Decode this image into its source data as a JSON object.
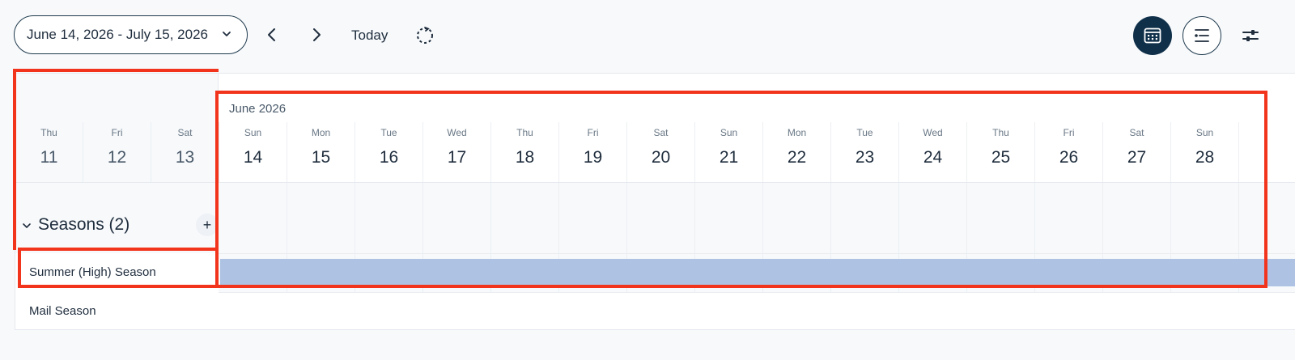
{
  "toolbar": {
    "date_range": "June 14, 2026 - July 15, 2026",
    "today_label": "Today",
    "icons": {
      "date_dropdown": "chevron-down-icon",
      "prev": "chevron-left-icon",
      "next": "chevron-right-icon",
      "refresh": "refresh-icon",
      "calendar_view": "calendar-grid-icon",
      "list_view": "list-icon",
      "filters": "sliders-icon"
    },
    "active_view": "calendar"
  },
  "calendar": {
    "month_label": "June 2026",
    "days": [
      {
        "dow": "Thu",
        "num": "11"
      },
      {
        "dow": "Fri",
        "num": "12"
      },
      {
        "dow": "Sat",
        "num": "13"
      },
      {
        "dow": "Sun",
        "num": "14"
      },
      {
        "dow": "Mon",
        "num": "15"
      },
      {
        "dow": "Tue",
        "num": "16"
      },
      {
        "dow": "Wed",
        "num": "17"
      },
      {
        "dow": "Thu",
        "num": "18"
      },
      {
        "dow": "Fri",
        "num": "19"
      },
      {
        "dow": "Sat",
        "num": "20"
      },
      {
        "dow": "Sun",
        "num": "21"
      },
      {
        "dow": "Mon",
        "num": "22"
      },
      {
        "dow": "Tue",
        "num": "23"
      },
      {
        "dow": "Wed",
        "num": "24"
      },
      {
        "dow": "Thu",
        "num": "25"
      },
      {
        "dow": "Fri",
        "num": "26"
      },
      {
        "dow": "Sat",
        "num": "27"
      },
      {
        "dow": "Sun",
        "num": "28"
      }
    ],
    "seasons_title": "Seasons (2)",
    "add_label": "+",
    "seasons": [
      {
        "name": "Summer (High) Season"
      },
      {
        "name": "Mail Season"
      }
    ]
  },
  "colors": {
    "accent": "#10304a",
    "season_bar": "#aec3e3",
    "highlight": "#f2341c"
  }
}
